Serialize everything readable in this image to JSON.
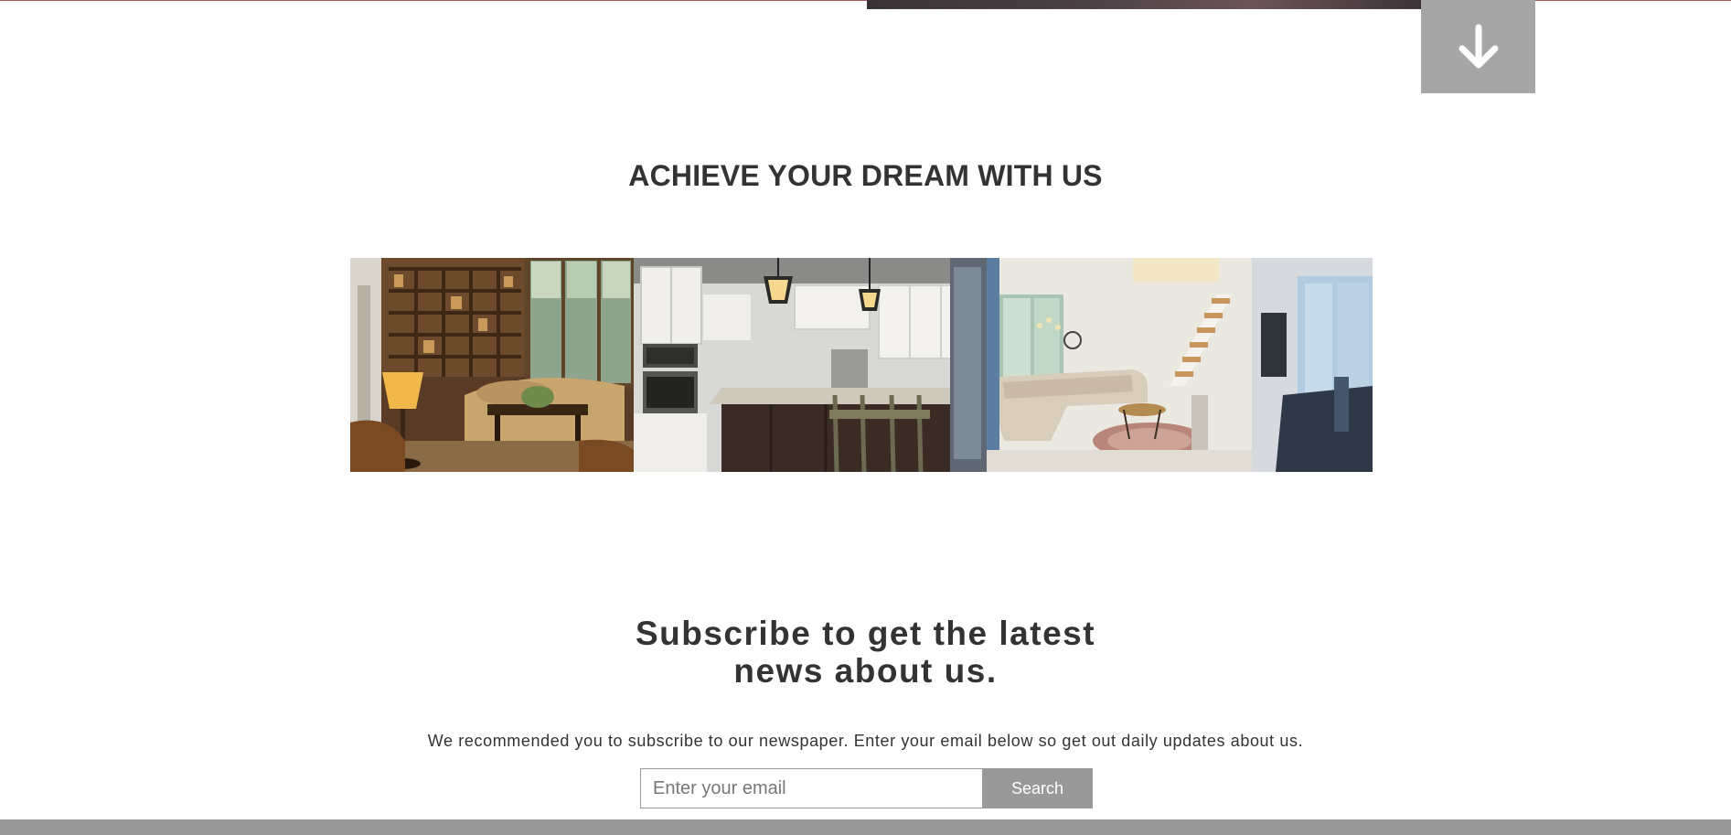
{
  "hero": {
    "scroll_down_icon": "arrow-down-icon"
  },
  "dream_section": {
    "title": "ACHIEVE YOUR DREAM WITH US",
    "photos": [
      "living-room-photo",
      "kitchen-photo",
      "modern-lounge-photo"
    ]
  },
  "subscribe": {
    "title_line1": "Subscribe to get the latest",
    "title_line2": "news about us.",
    "description": "We recommended you to subscribe to our newspaper. Enter your email below so get out daily updates about us.",
    "email_placeholder": "Enter your email",
    "search_label": "Search"
  },
  "colors": {
    "accent_line": "#a85560",
    "button_gray": "#a6a6a6",
    "form_gray": "#999999",
    "text": "#333333"
  }
}
